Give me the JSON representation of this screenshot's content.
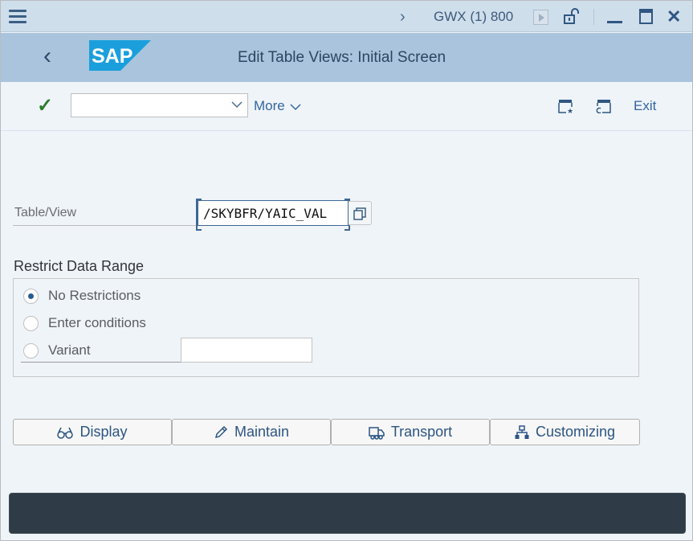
{
  "titlebar": {
    "system_info": "GWX (1) 800",
    "icons": [
      "menu-icon",
      "chevron-right-icon",
      "play-icon",
      "lock-open-icon",
      "minimize-icon",
      "maximize-icon",
      "close-icon"
    ]
  },
  "header": {
    "title": "Edit Table Views: Initial Screen",
    "logo_text": "SAP",
    "brand_color": "#1a9fdc"
  },
  "toolbar": {
    "command_field_value": "",
    "command_field_placeholder": "",
    "more_label": "More",
    "exit_label": "Exit"
  },
  "form": {
    "table_view_label": "Table/View",
    "table_view_value": "/SKYBFR/YAIC_VAL",
    "restrict_title": "Restrict Data Range",
    "radios": [
      {
        "label": "No Restrictions",
        "checked": true
      },
      {
        "label": "Enter conditions",
        "checked": false
      },
      {
        "label": "Variant",
        "checked": false
      }
    ],
    "variant_value": ""
  },
  "buttons": [
    {
      "label": "Display",
      "icon": "glasses-icon"
    },
    {
      "label": "Maintain",
      "icon": "pencil-icon"
    },
    {
      "label": "Transport",
      "icon": "truck-icon"
    },
    {
      "label": "Customizing",
      "icon": "hierarchy-icon"
    }
  ],
  "colors": {
    "accent": "#2c5584",
    "check": "#2b7d2b",
    "statusbar": "#2f3c48"
  }
}
